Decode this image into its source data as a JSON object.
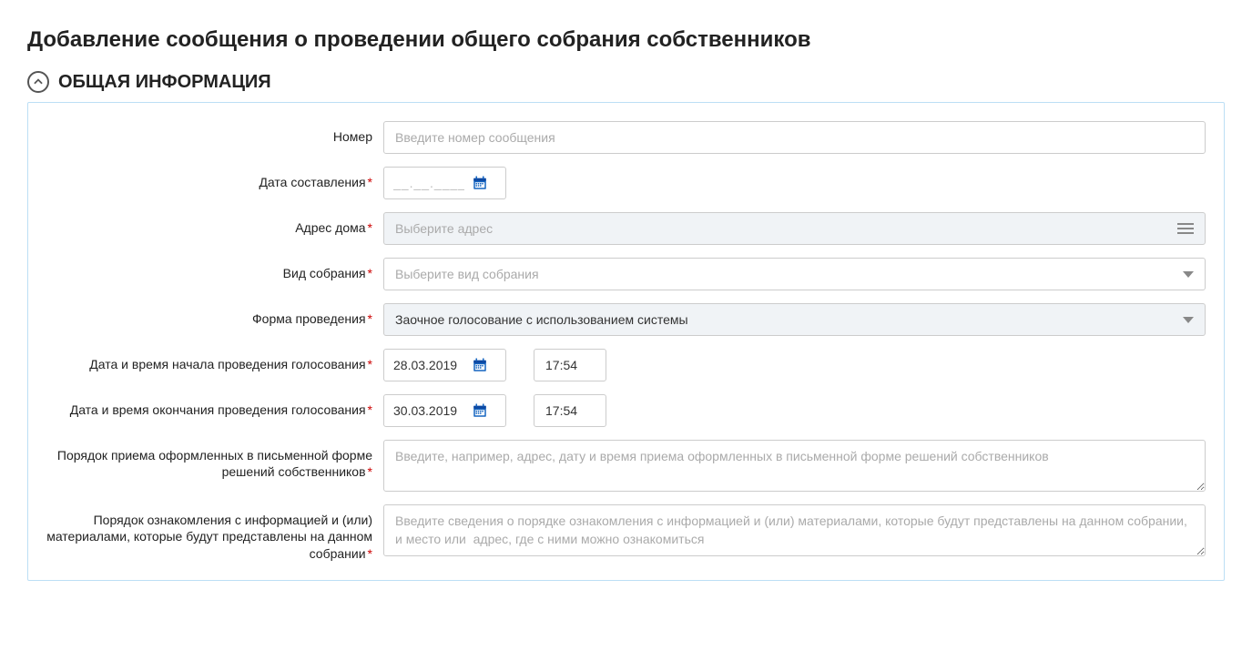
{
  "page_title": "Добавление сообщения о проведении общего собрания собственников",
  "section": {
    "title": "ОБЩАЯ ИНФОРМАЦИЯ"
  },
  "fields": {
    "number": {
      "label": "Номер",
      "placeholder": "Введите номер сообщения",
      "value": ""
    },
    "date_created": {
      "label": "Дата составления",
      "placeholder": "__.__.____",
      "value": ""
    },
    "address": {
      "label": "Адрес дома",
      "placeholder": "Выберите адрес",
      "value": ""
    },
    "meeting_type": {
      "label": "Вид собрания",
      "placeholder": "Выберите вид собрания",
      "value": ""
    },
    "form": {
      "label": "Форма проведения",
      "value": "Заочное голосование с использованием системы"
    },
    "start": {
      "label": "Дата и время начала проведения голосования",
      "date": "28.03.2019",
      "time": "17:54"
    },
    "end": {
      "label": "Дата и время окончания проведения голосования",
      "date": "30.03.2019",
      "time": "17:54"
    },
    "written_decisions": {
      "label": "Порядок приема оформленных в письменной форме решений собственников",
      "placeholder": "Введите, например, адрес, дату и время приема оформленных в письменной форме решений собственников",
      "value": ""
    },
    "info_access": {
      "label": "Порядок ознакомления с информацией и (или) материалами, которые будут представлены на данном собрании",
      "placeholder": "Введите сведения о порядке ознакомления с информацией и (или) материалами, которые будут представлены на данном собрании, и место или  адрес, где с ними можно ознакомиться",
      "value": ""
    }
  }
}
